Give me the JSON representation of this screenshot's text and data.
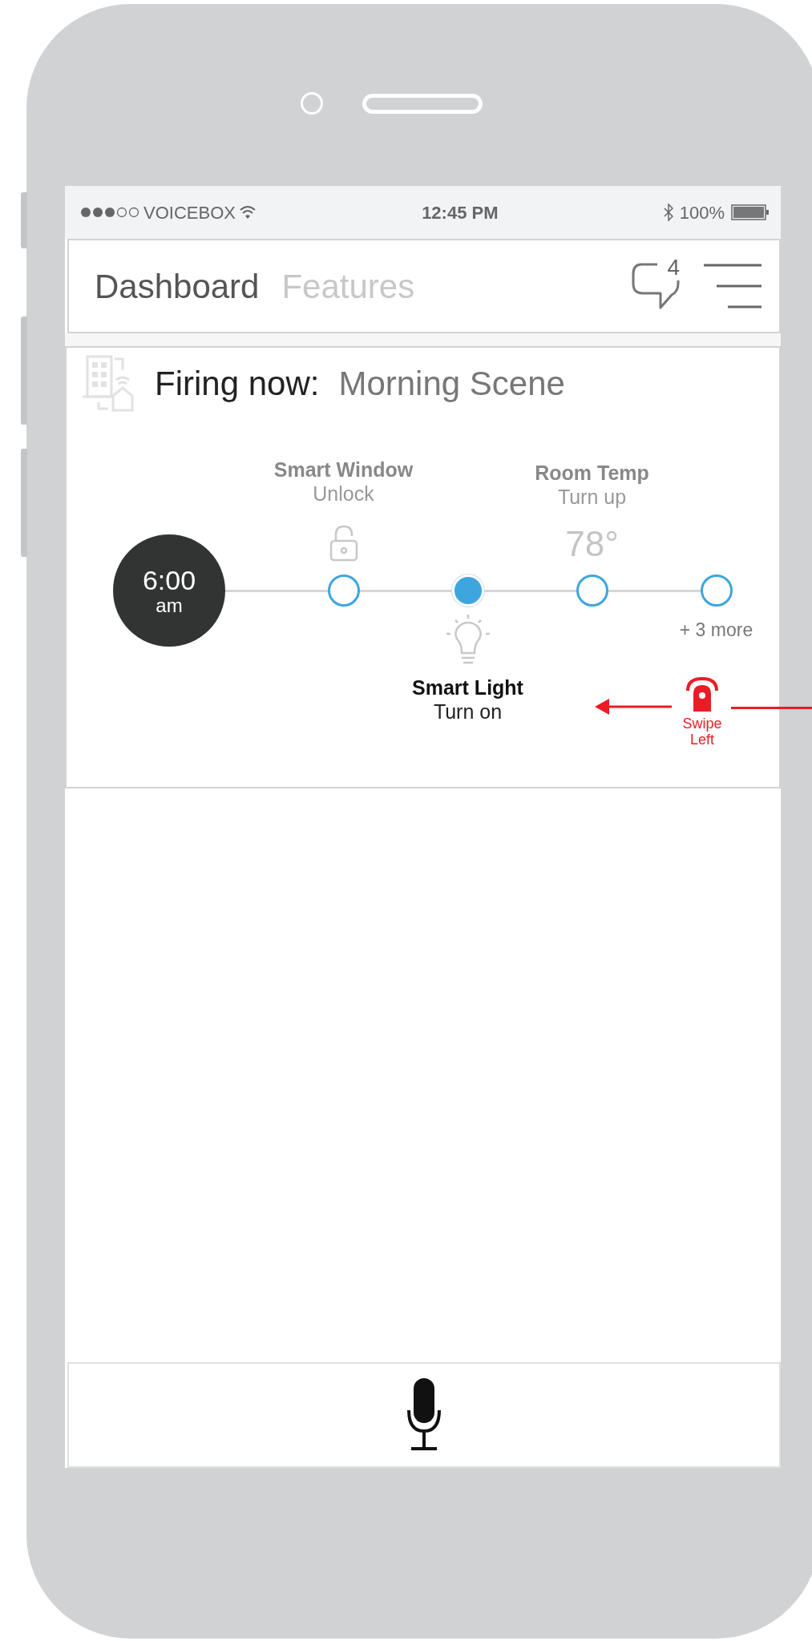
{
  "status_bar": {
    "carrier": "VOICEBOX",
    "time": "12:45 PM",
    "battery": "100%"
  },
  "header": {
    "tabs": [
      {
        "label": "Dashboard",
        "selected": true
      },
      {
        "label": "Features",
        "selected": false
      }
    ],
    "message_count": "4"
  },
  "scene": {
    "prefix": "Firing now:",
    "name": "Morning Scene",
    "time": "6:00",
    "period": "am",
    "steps": [
      {
        "kind": "lock",
        "title": "Smart Window",
        "action": "Unlock",
        "selected": false
      },
      {
        "kind": "bulb",
        "title": "Smart Light",
        "action": "Turn on",
        "selected": true
      },
      {
        "kind": "temperature",
        "title": "Room Temp",
        "action": "Turn up",
        "reading": "78°",
        "selected": false
      },
      {
        "kind": "more",
        "label": "+ 3 more",
        "selected": false
      }
    ]
  },
  "gesture_hint": {
    "label": "Swipe Left"
  }
}
